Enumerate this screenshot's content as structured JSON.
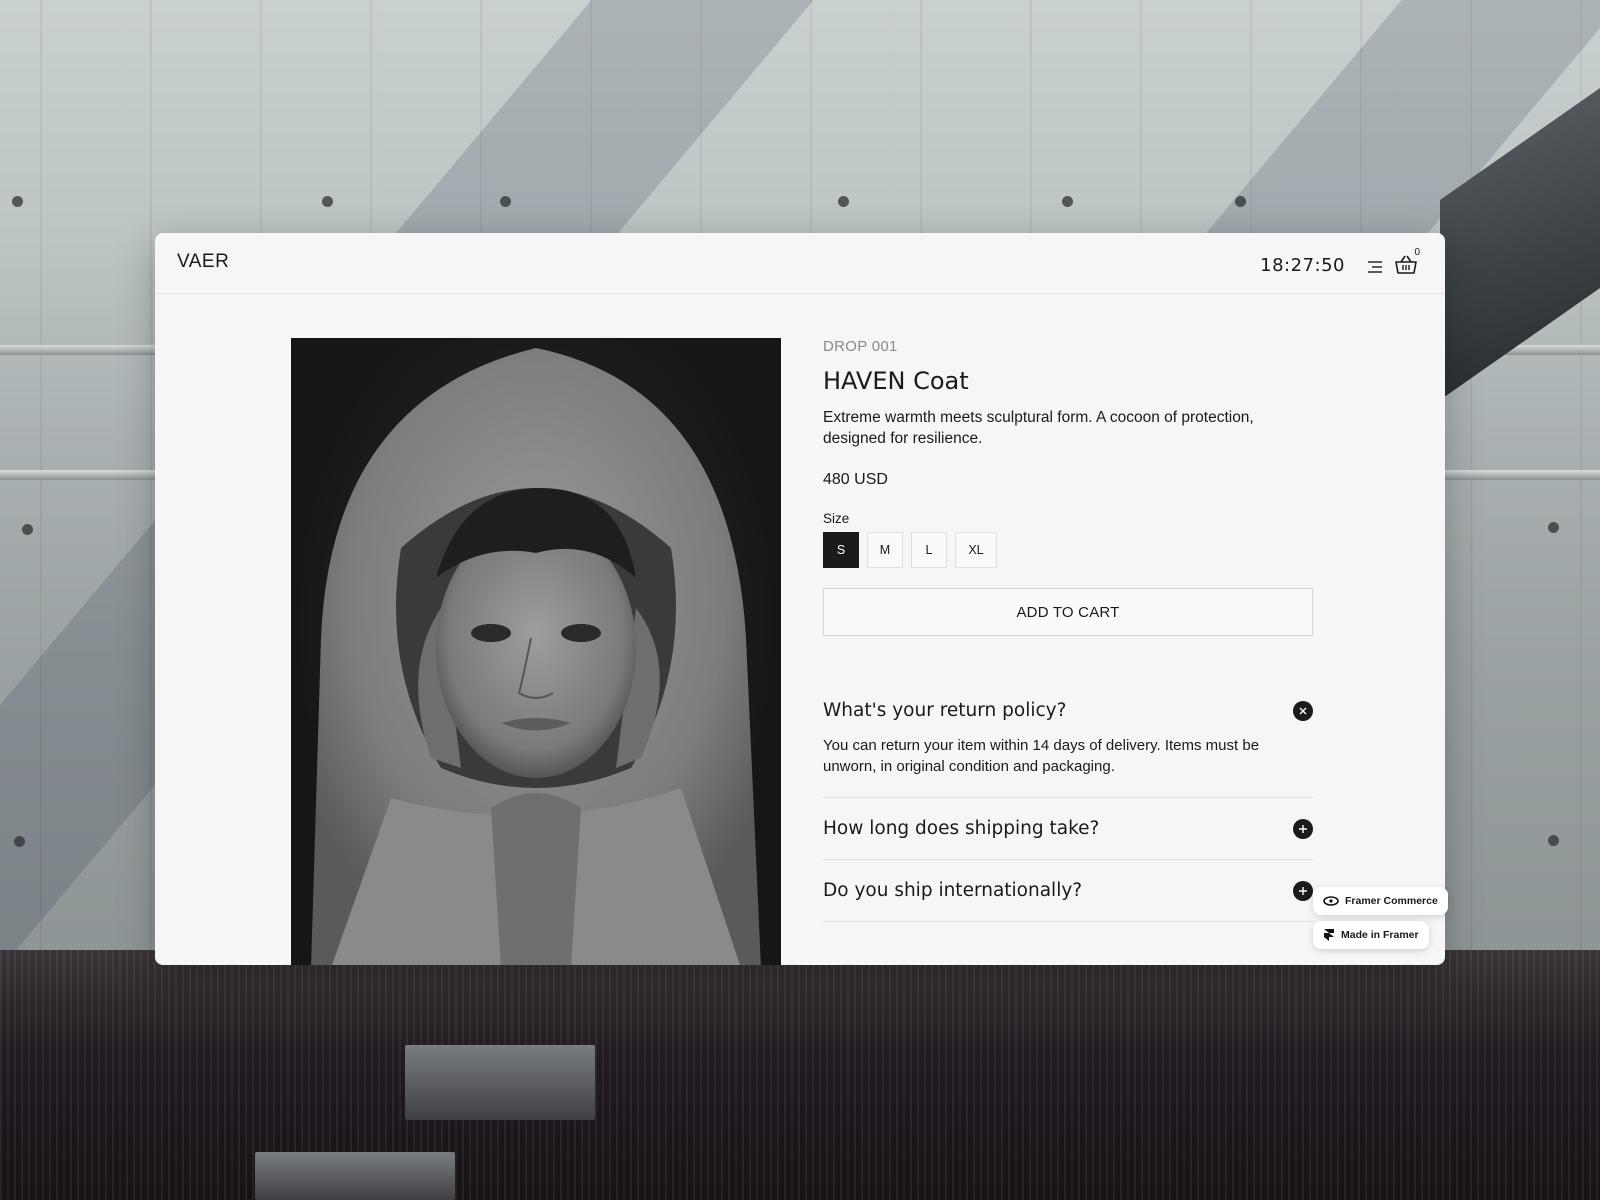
{
  "header": {
    "brand": "VAER",
    "clock": "18:27:50",
    "cart_count": "0"
  },
  "product": {
    "drop": "DROP 001",
    "title": "HAVEN Coat",
    "description": "Extreme warmth meets sculptural form. A cocoon of protection, designed for resilience.",
    "price": "480 USD",
    "size_label": "Size",
    "sizes": [
      "S",
      "M",
      "L",
      "XL"
    ],
    "selected_size": "S",
    "add_to_cart": "ADD TO CART"
  },
  "faq": [
    {
      "question": "What's your return policy?",
      "answer": "You can return your item within 14 days of delivery. Items must be unworn, in original condition and packaging.",
      "expanded": true
    },
    {
      "question": "How long does shipping take?",
      "expanded": false
    },
    {
      "question": "Do you ship internationally?",
      "expanded": false
    }
  ],
  "badges": {
    "framer_commerce": "Framer Commerce",
    "made_in_framer": "Made in Framer"
  }
}
